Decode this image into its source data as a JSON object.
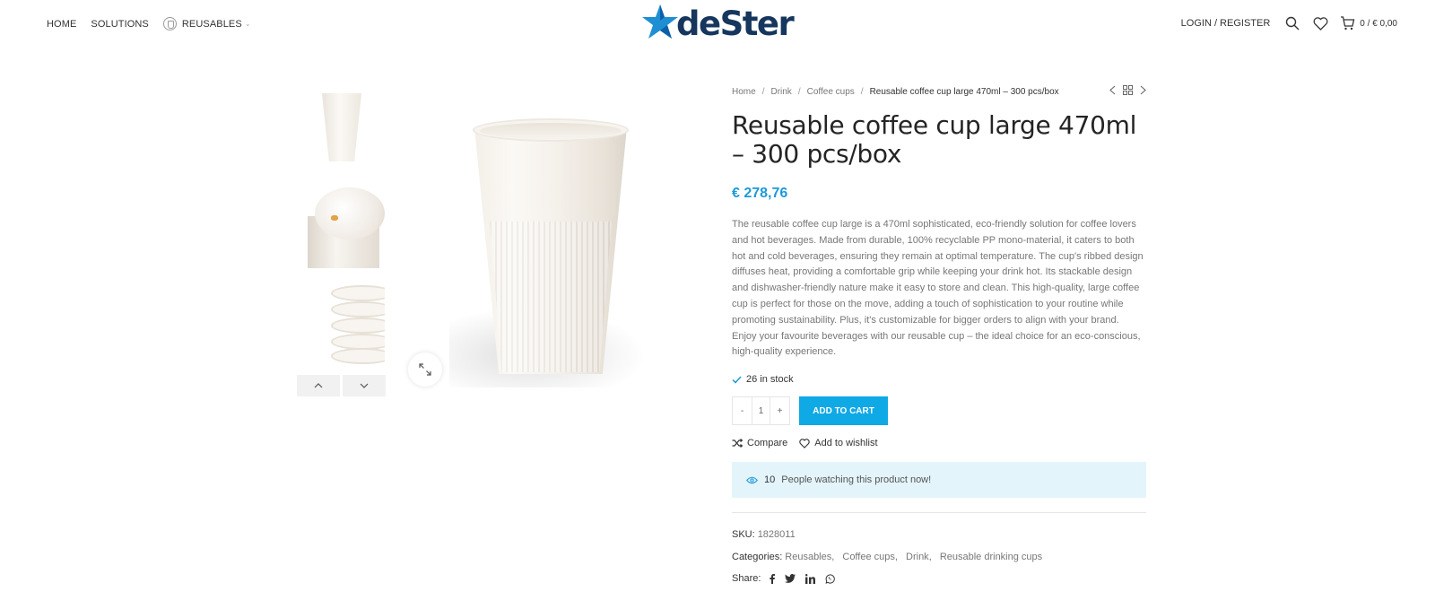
{
  "header": {
    "nav": [
      {
        "label": "HOME"
      },
      {
        "label": "SOLUTIONS"
      },
      {
        "label": "REUSABLES"
      }
    ],
    "logo_text": "deSter",
    "login_label": "LOGIN / REGISTER",
    "cart_summary": "0 / € 0,00"
  },
  "gallery": {
    "thumbnails": [
      "cup-front",
      "cup-with-lid",
      "cups-stacked"
    ]
  },
  "breadcrumb": [
    {
      "label": "Home"
    },
    {
      "label": "Drink"
    },
    {
      "label": "Coffee cups"
    },
    {
      "label": "Reusable coffee cup large 470ml – 300 pcs/box"
    }
  ],
  "product": {
    "title": "Reusable coffee cup large 470ml – 300 pcs/box",
    "price": "€ 278,76",
    "description": "The reusable coffee cup large is a 470ml sophisticated, eco-friendly solution for coffee lovers and hot beverages. Made from durable, 100% recyclable PP mono-material, it caters to both hot and cold beverages, ensuring they remain at optimal temperature. The cup's ribbed design diffuses heat, providing a comfortable grip while keeping your drink hot. Its stackable design and dishwasher-friendly nature make it easy to store and clean. This high-quality, large coffee cup is perfect for those on the move, adding a touch of sophistication to your routine while promoting sustainability. Plus, it's customizable for bigger orders to align with your brand. Enjoy your favourite beverages with our reusable cup – the ideal choice for an eco-conscious, high-quality experience.",
    "stock": "26 in stock",
    "qty_minus": "-",
    "qty_value": "1",
    "qty_plus": "+",
    "add_to_cart": "ADD TO CART",
    "compare": "Compare",
    "wishlist": "Add to wishlist",
    "watching_count": "10",
    "watching_text": "People watching this product now!",
    "sku_label": "SKU:",
    "sku": "1828011",
    "categories_label": "Categories:",
    "categories": [
      "Reusables",
      "Coffee cups",
      "Drink",
      "Reusable drinking cups"
    ],
    "share_label": "Share:",
    "share_icons": [
      "facebook-icon",
      "twitter-icon",
      "linkedin-icon",
      "whatsapp-icon"
    ]
  },
  "colors": {
    "accent": "#0fa9e6",
    "price": "#1d9ad6",
    "brand_navy": "#16365e",
    "watching_bg": "#e3f4fb"
  }
}
